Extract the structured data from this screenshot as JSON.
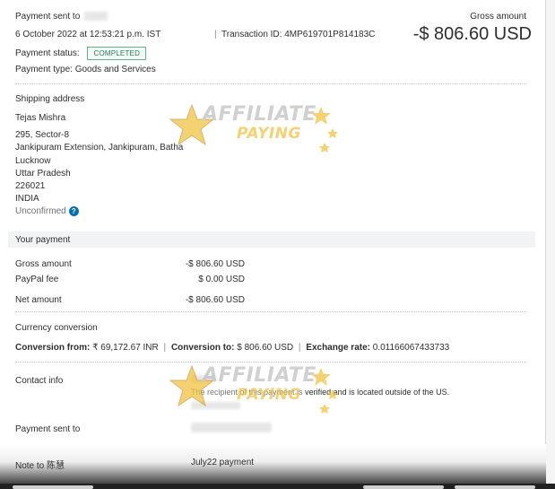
{
  "header": {
    "payment_sent_to_label": "Payment sent to",
    "datetime": "6 October 2022 at 12:53:21 p.m. IST",
    "transaction_sep": "|",
    "transaction_id": "Transaction ID: 4MP619701P814183C",
    "status_label": "Payment status:",
    "status_badge": "COMPLETED",
    "type_label": "Payment type: Goods and Services",
    "gross_label": "Gross amount",
    "gross_amount": "-$ 806.60 USD"
  },
  "shipping": {
    "title": "Shipping address",
    "lines": [
      "Tejas Mishra",
      "295, Sector-8",
      "Jankipuram Extension, Jankipuram, Batha",
      "Lucknow",
      "Uttar Pradesh",
      "226021",
      "INDIA"
    ],
    "status": "Unconfirmed"
  },
  "your_payment": {
    "title": "Your payment",
    "rows": [
      {
        "label": "Gross amount",
        "value": "-$ 806.60 USD"
      },
      {
        "label": "PayPal fee",
        "value": "$ 0.00 USD"
      },
      {
        "label": "Net amount",
        "value": "-$ 806.60 USD"
      }
    ]
  },
  "currency": {
    "title": "Currency conversion",
    "from_label": "Conversion from:",
    "from_value": "₹ 69,172.67 INR",
    "to_label": "Conversion to:",
    "to_value": "$ 806.60 USD",
    "rate_label": "Exchange rate:",
    "rate_value": "0.01166067433733",
    "separator": "|"
  },
  "contact": {
    "title": "Contact info",
    "note_prefix": "The recipient of this payment is",
    "note_suffix": "verified and is located outside of the US."
  },
  "payment_sent_to": {
    "label": "Payment sent to"
  },
  "note": {
    "label": "Note to 陈慧",
    "value": "July22 payment"
  },
  "watermark": {
    "line1": "AFFILIATE",
    "line2": "PAYING"
  },
  "colors": {
    "accent": "#0070ba",
    "badge_green": "#2a7a52",
    "band": "#f1f3f5",
    "watermark_gold": "#f2c13b"
  }
}
